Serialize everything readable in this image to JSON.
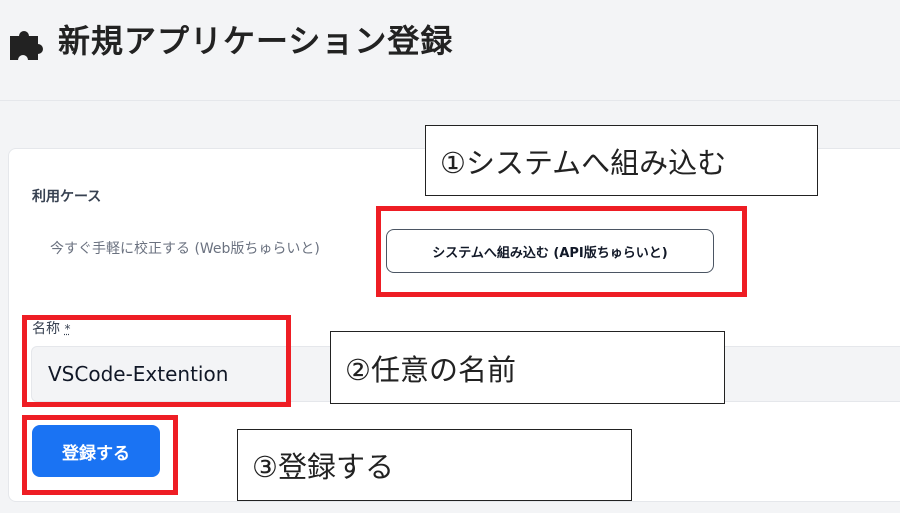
{
  "header": {
    "icon": "puzzle-icon",
    "title": "新規アプリケーション登録"
  },
  "form": {
    "usecase_label": "利用ケース",
    "usecase_options": [
      {
        "label": "今すぐ手軽に校正する (Web版ちゅらいと)",
        "selected": false
      },
      {
        "label": "システムへ組み込む (API版ちゅらいと)",
        "selected": true
      }
    ],
    "name_label": "名称",
    "required_mark": "*",
    "name_value": "VSCode-Extention",
    "submit_label": "登録する"
  },
  "annotations": {
    "callouts": [
      "①システムへ組み込む",
      "②任意の名前",
      "③登録する"
    ]
  },
  "colors": {
    "primary": "#1a73f3",
    "highlight": "#ee1d24",
    "background": "#f3f4f6"
  }
}
